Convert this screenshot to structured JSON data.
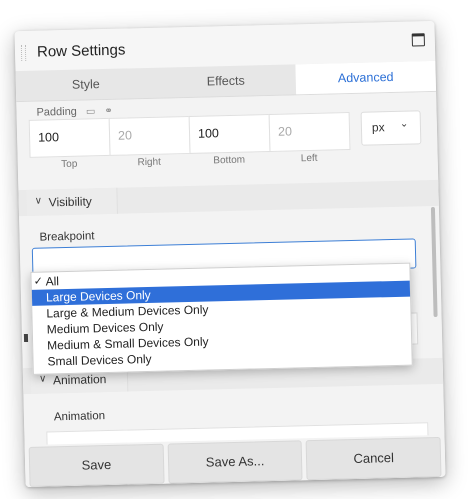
{
  "window": {
    "title": "Row Settings"
  },
  "tabs": [
    {
      "label": "Style",
      "active": false
    },
    {
      "label": "Effects",
      "active": false
    },
    {
      "label": "Advanced",
      "active": true
    }
  ],
  "padding": {
    "label": "Padding",
    "top": {
      "value": "100",
      "label": "Top"
    },
    "right": {
      "placeholder": "20",
      "label": "Right"
    },
    "bottom": {
      "value": "100",
      "label": "Bottom"
    },
    "left": {
      "placeholder": "20",
      "label": "Left"
    },
    "unit": "px"
  },
  "visibility": {
    "section_label": "Visibility",
    "breakpoint_label": "Breakpoint",
    "options": [
      {
        "label": "All",
        "checked": true
      },
      {
        "label": "Large Devices Only",
        "highlighted": true
      },
      {
        "label": "Large & Medium Devices Only"
      },
      {
        "label": "Medium Devices Only"
      },
      {
        "label": "Medium & Small Devices Only"
      },
      {
        "label": "Small Devices Only"
      }
    ]
  },
  "animation": {
    "section_label": "Animation",
    "field_label": "Animation"
  },
  "footer": {
    "save": "Save",
    "save_as": "Save As...",
    "cancel": "Cancel"
  },
  "colors": {
    "accent": "#2f6fd9",
    "tab_active_text": "#2b6fd6"
  }
}
